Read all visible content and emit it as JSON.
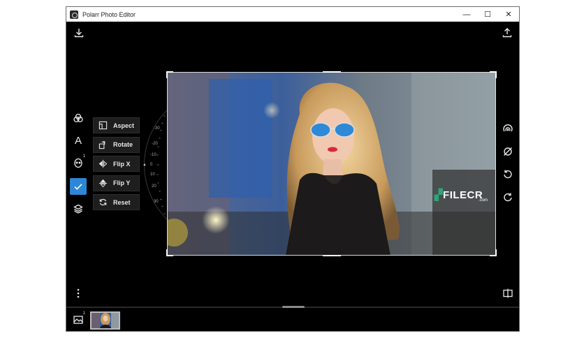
{
  "window": {
    "title": "Polarr Photo Editor",
    "controls": {
      "minimize": "—",
      "maximize": "☐",
      "close": "✕"
    }
  },
  "left_toolbar": {
    "tools": [
      {
        "name": "filters-icon"
      },
      {
        "name": "text-icon",
        "label": "A"
      },
      {
        "name": "face-icon",
        "badge": "1"
      },
      {
        "name": "crop-check-icon"
      },
      {
        "name": "layers-icon"
      }
    ]
  },
  "crop_menu": {
    "items": [
      {
        "label": "Aspect"
      },
      {
        "label": "Rotate"
      },
      {
        "label": "Flip X"
      },
      {
        "label": "Flip Y"
      },
      {
        "label": "Reset"
      }
    ]
  },
  "rotation_dial": {
    "labels": [
      "-30",
      "-20",
      "-10",
      "0",
      "10",
      "20",
      "30"
    ]
  },
  "watermark": {
    "brand": "FILECR",
    "sub": ".com"
  },
  "thumbnail_strip": {
    "badge": "1"
  },
  "colors": {
    "accent": "#2d86d6",
    "background": "#000000"
  }
}
